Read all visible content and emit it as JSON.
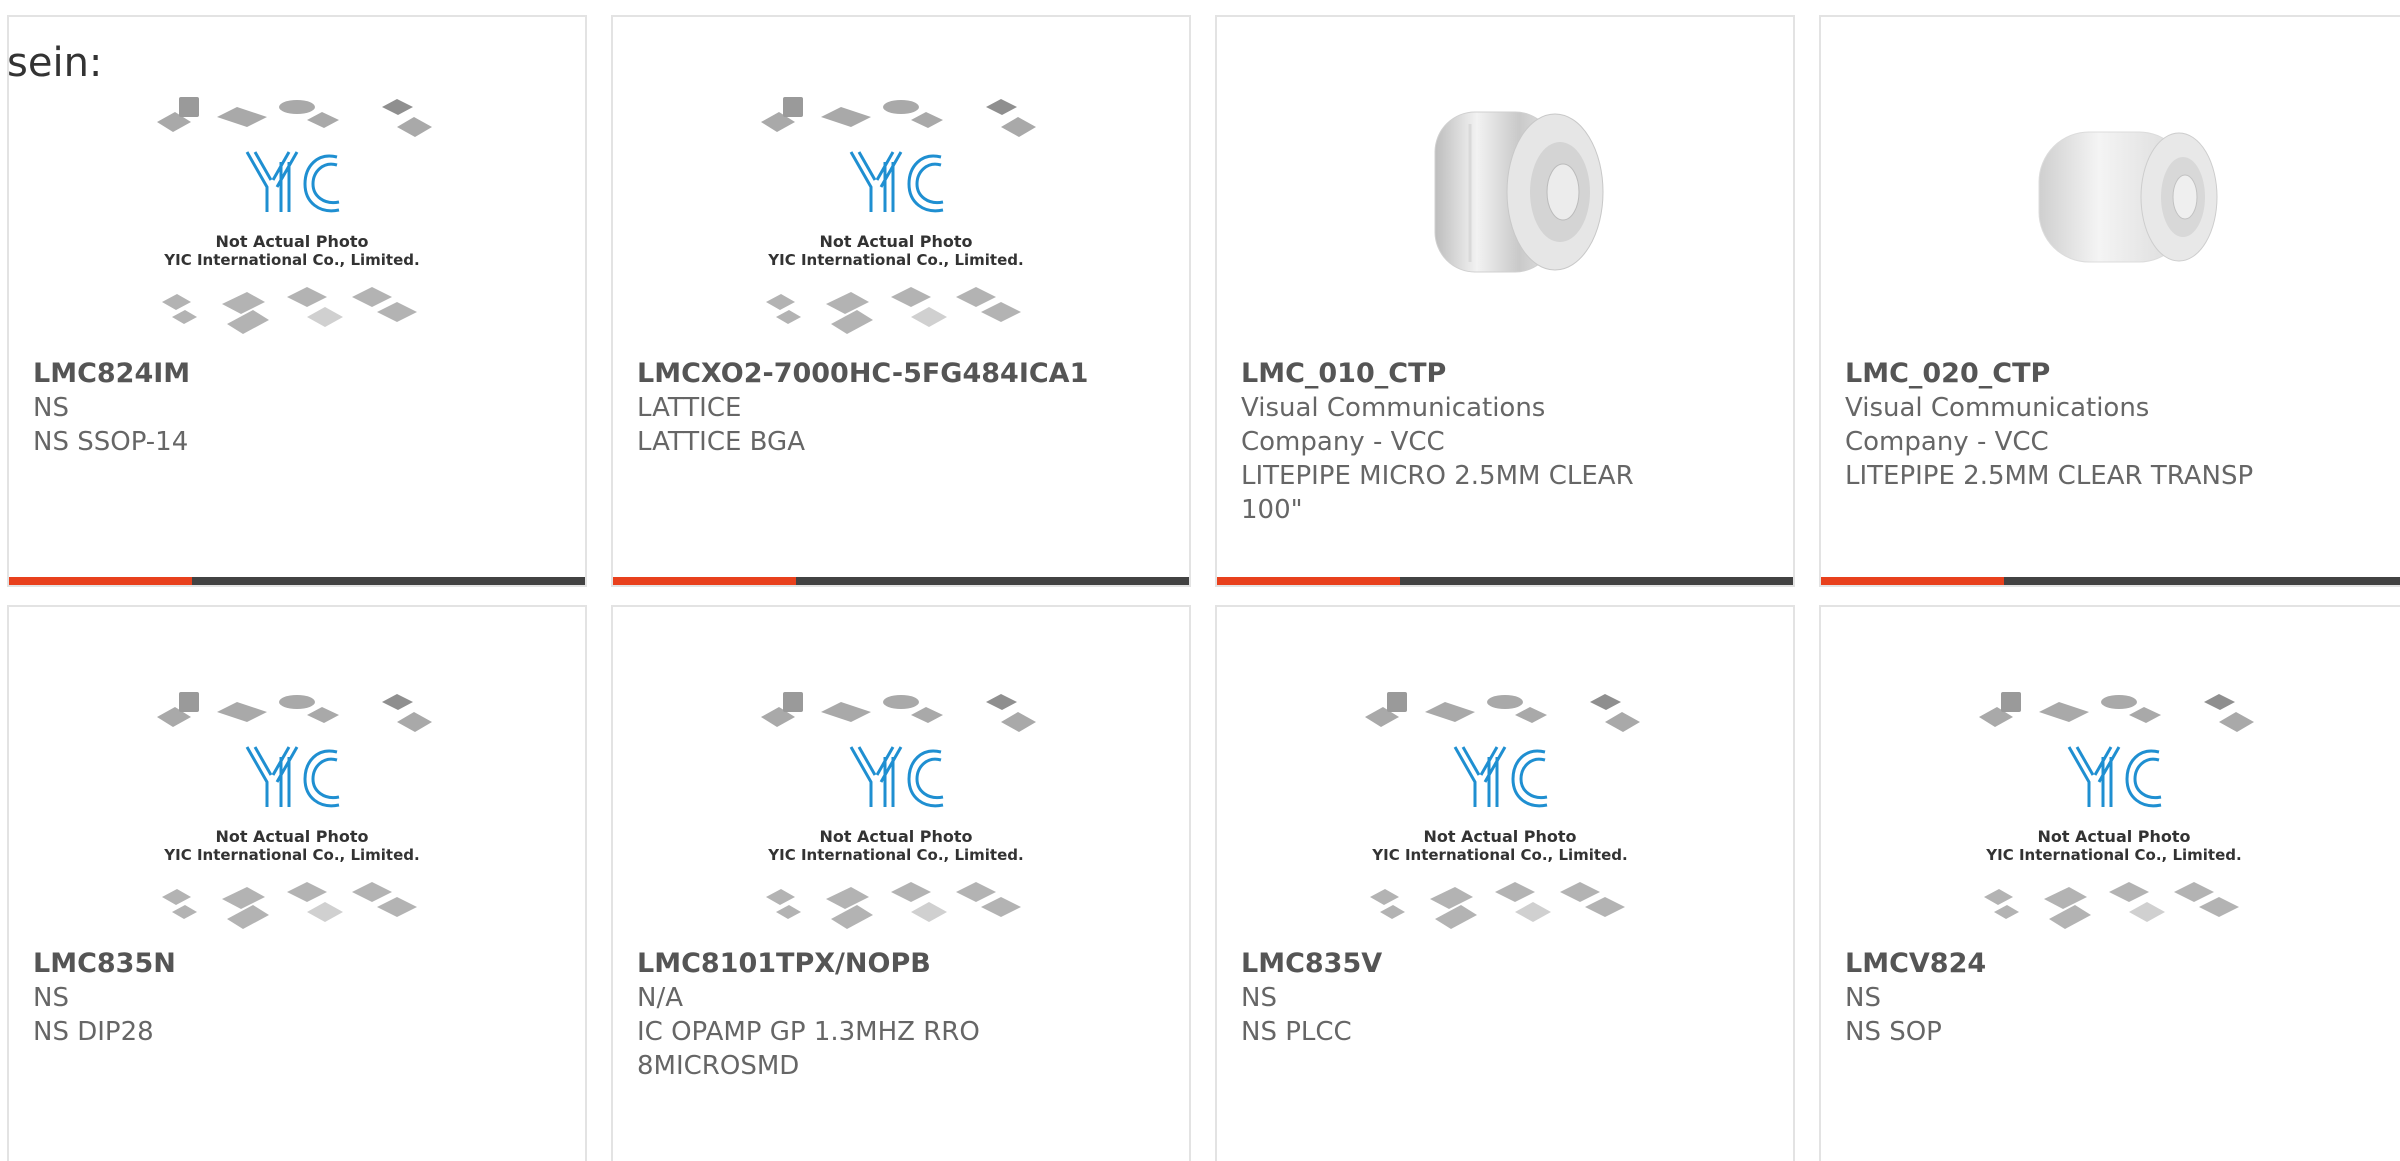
{
  "page_fragment": "sein:",
  "colors": {
    "accent": "#e8401c",
    "bar": "#424242",
    "brand_blue": "#1f8fd1"
  },
  "placeholder": {
    "line1": "Not Actual Photo",
    "line2": "YIC International Co., Limited."
  },
  "products": [
    {
      "part": "LMC824IM",
      "maker": "NS",
      "desc": "NS SSOP-14",
      "image": "placeholder"
    },
    {
      "part": "LMCXO2-7000HC-5FG484ICA1",
      "maker": "LATTICE",
      "desc": "LATTICE BGA",
      "image": "placeholder"
    },
    {
      "part": "LMC_010_CTP",
      "maker": "Visual Communications Company - VCC",
      "desc": "LITEPIPE MICRO 2.5MM CLEAR 100\"",
      "image": "litepipe-short"
    },
    {
      "part": "LMC_020_CTP",
      "maker": "Visual Communications Company - VCC",
      "desc": "LITEPIPE 2.5MM CLEAR TRANSP",
      "image": "litepipe-long"
    },
    {
      "part": "LMC835N",
      "maker": "NS",
      "desc": "NS DIP28",
      "image": "placeholder"
    },
    {
      "part": "LMC8101TPX/NOPB",
      "maker": "N/A",
      "desc": "IC OPAMP GP 1.3MHZ RRO 8MICROSMD",
      "image": "placeholder"
    },
    {
      "part": "LMC835V",
      "maker": "NS",
      "desc": "NS PLCC",
      "image": "placeholder"
    },
    {
      "part": "LMCV824",
      "maker": "NS",
      "desc": "NS SOP",
      "image": "placeholder"
    }
  ]
}
